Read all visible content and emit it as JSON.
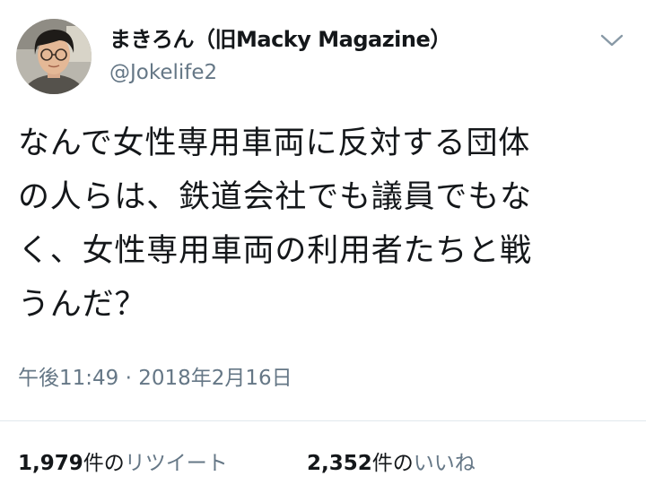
{
  "author": {
    "name": "まきろん（旧Macky Magazine）",
    "handle": "@Jokelife2"
  },
  "icons": {
    "more": "chevron-down-icon",
    "avatar": "avatar-photo"
  },
  "tweet": {
    "lines": [
      "なんで女性専用車両に反対する団体",
      "の人らは、鉄道会社でも議員でもな",
      "く、女性専用車両の利用者たちと戦",
      "うんだ？"
    ],
    "timestamp": "午後11:49 · 2018年2月16日"
  },
  "stats": {
    "retweets": {
      "count": "1,979",
      "unit": "件の",
      "label": "リツイート"
    },
    "likes": {
      "count": "2,352",
      "unit": "件の",
      "label": "いいね"
    }
  },
  "colors": {
    "text": "#14171a",
    "secondary": "#657786",
    "divider": "#e1e8ed",
    "background": "#ffffff"
  }
}
